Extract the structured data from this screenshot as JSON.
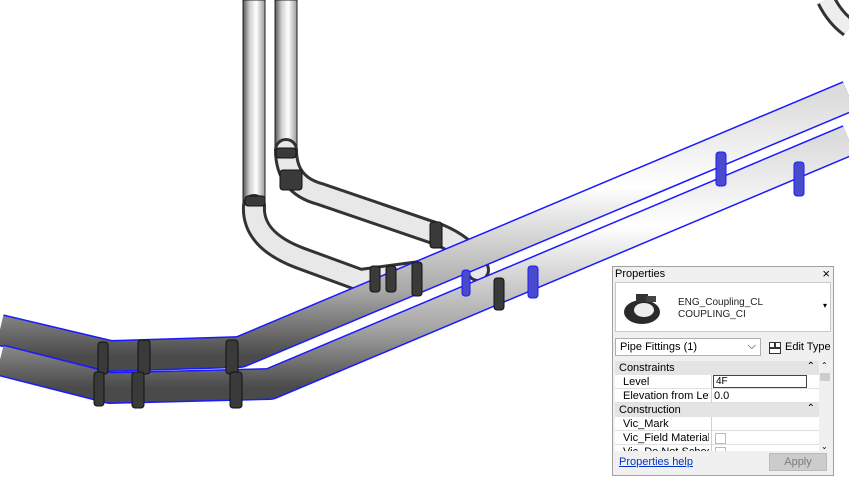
{
  "properties_panel": {
    "title": "Properties",
    "close_glyph": "×",
    "type_name_line1": "ENG_Coupling_CL",
    "type_name_line2": "COUPLING_CI",
    "type_dropdown_glyph": "▾",
    "category_filter": "Pipe Fittings (1)",
    "category_chevron": "⌵",
    "edit_type_label": "Edit Type",
    "groups": [
      {
        "name": "Constraints",
        "collapse_glyph": "⌃",
        "rows": [
          {
            "key": "Level",
            "value": "4F"
          },
          {
            "key": "Elevation from Level",
            "value": "0.0"
          }
        ]
      },
      {
        "name": "Construction",
        "collapse_glyph": "⌃",
        "rows": [
          {
            "key": "Vic_Mark",
            "value": ""
          },
          {
            "key": "Vic_Field Material",
            "value": ""
          },
          {
            "key": "Vic_Do Not Schedule",
            "value": ""
          }
        ]
      }
    ],
    "scroll_up_glyph": "⌃",
    "scroll_down_glyph": "⌄",
    "help_link": "Properties help",
    "apply_label": "Apply"
  },
  "icons": [
    "close-icon",
    "coupling-thumbnail-icon",
    "edit-type-icon",
    "checkbox-icon"
  ],
  "colors": {
    "pipe_outline": "#1a1aff",
    "panel_bg": "#f0f0f0",
    "group_bg": "#e4e4e4",
    "link": "#0033cc"
  }
}
